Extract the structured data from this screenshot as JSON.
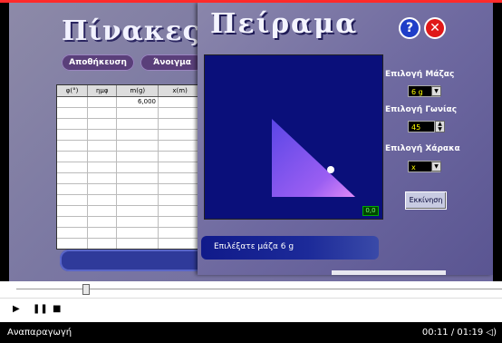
{
  "background_panel": {
    "title": "Πίνακες",
    "buttons": {
      "save": "Αποθήκευση",
      "open": "Άνοιγμα"
    },
    "table": {
      "columns": [
        "φ(°)",
        "ημφ",
        "m(g)",
        "x(m)"
      ],
      "rows": [
        [
          "",
          "",
          "6,000",
          ""
        ]
      ]
    }
  },
  "experiment": {
    "title": "Πείραμα",
    "help_icon": "?",
    "close_icon": "✕",
    "readout": "0,0",
    "mass_label": "Επιλογή Μάζας",
    "mass_value": "6 g",
    "angle_label": "Επιλογή Γωνίας",
    "angle_value": "45",
    "scale_label": "Επιλογή Χάρακα",
    "scale_value": "x",
    "start_button": "Εκκίνηση",
    "status_text": "Επιλέξατε μάζα  6 g"
  },
  "player": {
    "status_left": "Αναπαραγωγή",
    "time": "00:11 / 01:19"
  },
  "icons": [
    "help-icon",
    "close-icon",
    "play-icon",
    "pause-icon",
    "stop-icon",
    "volume-icon",
    "dropdown-arrow-icon",
    "spinner-icon"
  ]
}
